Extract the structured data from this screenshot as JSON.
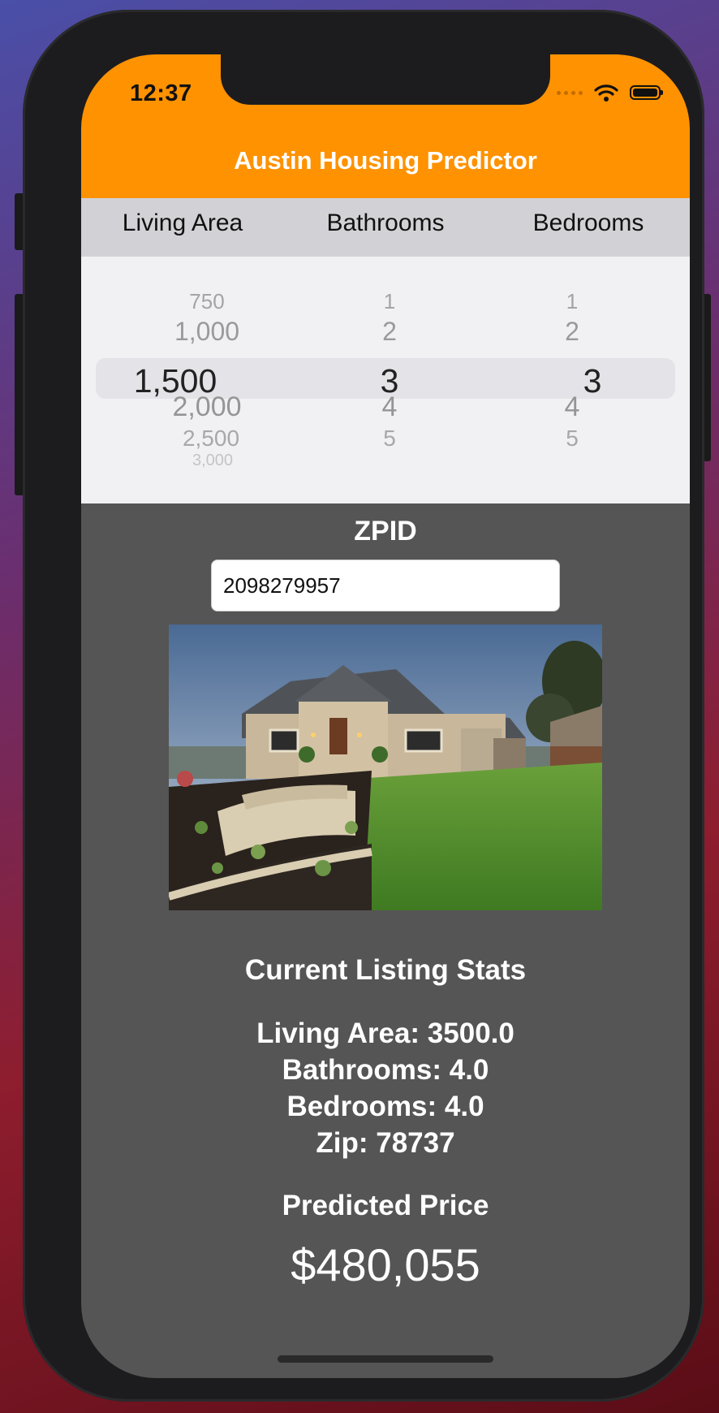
{
  "status_bar": {
    "time": "12:37"
  },
  "app": {
    "title": "Austin Housing Predictor"
  },
  "picker": {
    "headers": [
      "Living Area",
      "Bathrooms",
      "Bedrooms"
    ],
    "living_area": {
      "options": [
        "750",
        "1,000",
        "1,500",
        "2,000",
        "2,500",
        "3,000"
      ],
      "selected": "1,500"
    },
    "bathrooms": {
      "options": [
        "1",
        "2",
        "3",
        "4",
        "5"
      ],
      "selected": "3"
    },
    "bedrooms": {
      "options": [
        "1",
        "2",
        "3",
        "4",
        "5"
      ],
      "selected": "3"
    }
  },
  "zpid": {
    "label": "ZPID",
    "value": "2098279957"
  },
  "stats": {
    "title": "Current Listing Stats",
    "living_area": "Living Area: 3500.0",
    "bathrooms": "Bathrooms: 4.0",
    "bedrooms": "Bedrooms: 4.0",
    "zip": "Zip: 78737"
  },
  "prediction": {
    "label": "Predicted Price",
    "value": "$480,055"
  },
  "colors": {
    "header_bg": "#ff9200",
    "content_bg": "#555555",
    "picker_bg": "#f1f1f4",
    "column_header_bg": "#d2d2d6"
  }
}
